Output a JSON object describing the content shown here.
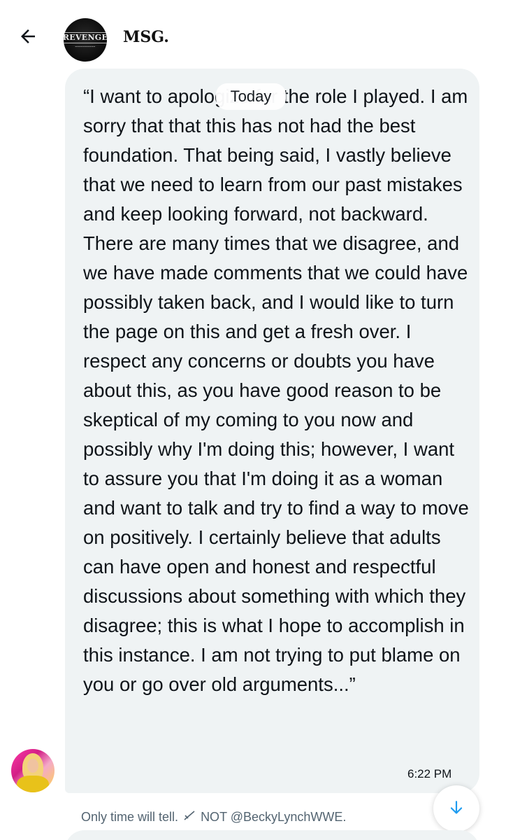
{
  "header": {
    "title": "MSG.",
    "logo_text": "REVENGE",
    "back_icon": "arrow-left-icon"
  },
  "date_divider": "Today",
  "message": {
    "text": "“I want to apologize for the role I played. I am sorry that that this has not had the best foundation. That being said, I vastly believe that we need to learn from our past mistakes and keep looking forward, not backward. There are many times that we disagree, and we have made comments that we could have possibly taken back, and I would like to turn the page on this and get a fresh over. I respect any concerns or doubts you have about this, as you have good reason to be skeptical of my coming to you now and possibly why I'm doing this; however, I want to assure you that I'm doing it as a woman and want to talk and try to find a way to move on positively. I certainly believe that adults can have open and honest and respectful discussions about something with which they disagree; this is what I hope to accomplish in this instance. I am not trying to put blame on you or go over old arguments...”",
    "time": "6:22 PM",
    "bubble_color": "#eff3f4"
  },
  "caption": {
    "before": "Only time will tell.",
    "icon": "strike-icon",
    "after": "NOT @BeckyLynchWWE."
  },
  "scroll_button": {
    "icon": "arrow-down-icon",
    "color": "#1d9bf0"
  }
}
